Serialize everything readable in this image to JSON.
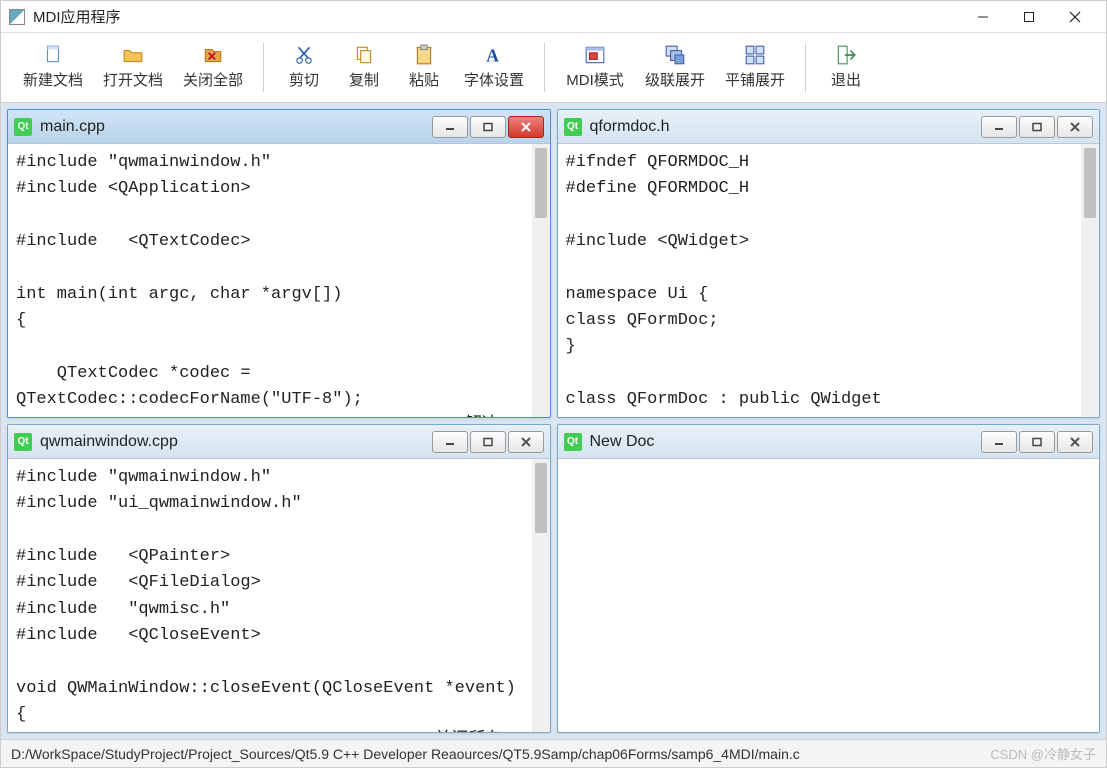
{
  "window": {
    "title": "MDI应用程序"
  },
  "toolbar": {
    "new_doc": "新建文档",
    "open_doc": "打开文档",
    "close_all": "关闭全部",
    "cut": "剪切",
    "copy": "复制",
    "paste": "粘贴",
    "font": "字体设置",
    "mdi_mode": "MDI模式",
    "cascade": "级联展开",
    "tile": "平铺展开",
    "exit": "退出"
  },
  "icons": {
    "qt_badge": "Qt"
  },
  "subwindows": [
    {
      "title": "main.cpp",
      "active": true,
      "content": "#include \"qwmainwindow.h\"\n#include <QApplication>\n\n#include   <QTextCodec>\n\nint main(int argc, char *argv[])\n{\n\n    QTextCodec *codec =\nQTextCodec::codecForName(\"UTF-8\");\n    QTextCodec::setCodecForLocale(codec); //解决"
    },
    {
      "title": "qformdoc.h",
      "active": false,
      "content": "#ifndef QFORMDOC_H\n#define QFORMDOC_H\n\n#include <QWidget>\n\nnamespace Ui {\nclass QFormDoc;\n}\n\nclass QFormDoc : public QWidget\n{"
    },
    {
      "title": "qwmainwindow.cpp",
      "active": false,
      "content": "#include \"qwmainwindow.h\"\n#include \"ui_qwmainwindow.h\"\n\n#include   <QPainter>\n#include   <QFileDialog>\n#include   \"qwmisc.h\"\n#include   <QCloseEvent>\n\nvoid QWMainWindow::closeEvent(QCloseEvent *event)\n{\n    ui->mdiArea->closeAllSubWindows(); //关闭所有"
    },
    {
      "title": "New Doc",
      "active": false,
      "content": ""
    }
  ],
  "statusbar": {
    "path": "D:/WorkSpace/StudyProject/Project_Sources/Qt5.9 C++ Developer Reaources/QT5.9Samp/chap06Forms/samp6_4MDI/main.c",
    "watermark": "CSDN @冷静女子"
  }
}
